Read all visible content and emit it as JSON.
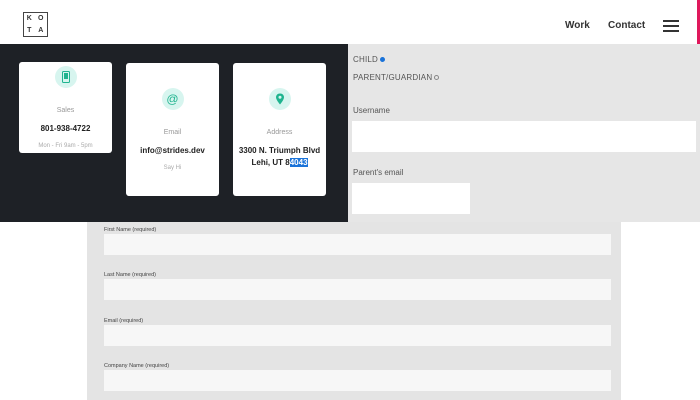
{
  "header": {
    "logo": [
      "K",
      "O",
      "T",
      "A"
    ],
    "nav": {
      "work": "Work",
      "contact": "Contact"
    }
  },
  "contact_cards": [
    {
      "icon": "phone-icon",
      "label": "Sales",
      "value": "801-938-4722",
      "sub": "Mon - Fri 9am - 5pm"
    },
    {
      "icon": "at-sign-icon",
      "label": "Email",
      "value": "info@strides.dev",
      "sub": "Say Hi"
    },
    {
      "icon": "map-pin-icon",
      "label": "Address",
      "value_line1": "3300 N. Triumph Blvd",
      "value_line2_prefix": "Lehi, UT 8",
      "value_line2_selected": "4043"
    }
  ],
  "role_options": [
    {
      "label": "CHILD",
      "selected": true
    },
    {
      "label": "PARENT/GUARDIAN",
      "selected": false
    }
  ],
  "upper_form": {
    "username_label": "Username",
    "parent_email_label": "Parent's email"
  },
  "lower_form": {
    "fields": [
      "First Name (required)",
      "Last Name (required)",
      "Email (required)",
      "Company Name (required)"
    ]
  },
  "colors": {
    "accent_pink": "#e0185c",
    "dark_panel": "#1e2126",
    "icon_teal": "#20b48f",
    "selection_blue": "#1a73d9"
  }
}
